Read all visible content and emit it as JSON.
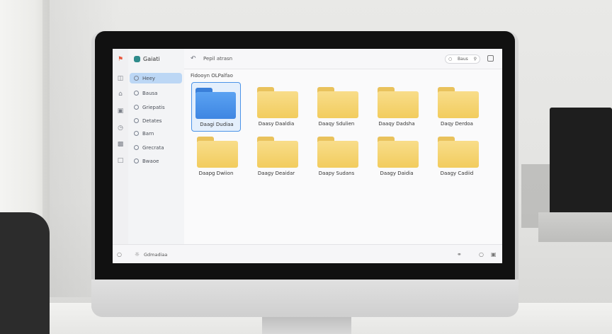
{
  "window": {
    "title": "Gaiati"
  },
  "toolbar": {
    "location": "Pepil atrasn",
    "search_label": "Baus"
  },
  "breadcrumb": "Fidooyn OLPalfao",
  "sidebar": {
    "items": [
      {
        "label": "Heey",
        "active": true
      },
      {
        "label": "Bausa"
      },
      {
        "label": "Griepatis"
      },
      {
        "label": "Detates"
      },
      {
        "label": "Barn"
      },
      {
        "label": "Grecrata"
      },
      {
        "label": "Bwaoe"
      }
    ]
  },
  "folders": [
    {
      "name": "Daagi Dudiaa",
      "selected": true
    },
    {
      "name": "Daasy Daaldia"
    },
    {
      "name": "Daaqy Sdulien"
    },
    {
      "name": "Daaqy Dadsha"
    },
    {
      "name": "Daqy Derdoa"
    },
    {
      "name": "Daapg Dwiion"
    },
    {
      "name": "Daagy Deaidar"
    },
    {
      "name": "Daapy Sudans"
    },
    {
      "name": "Daagy Daidia"
    },
    {
      "name": "Daagy Cadiid"
    }
  ],
  "status": {
    "text": "Gdmadiaa"
  },
  "colors": {
    "accent": "#4b93e8",
    "selection": "#bcd7f5",
    "folder": "#f2cc5e"
  }
}
